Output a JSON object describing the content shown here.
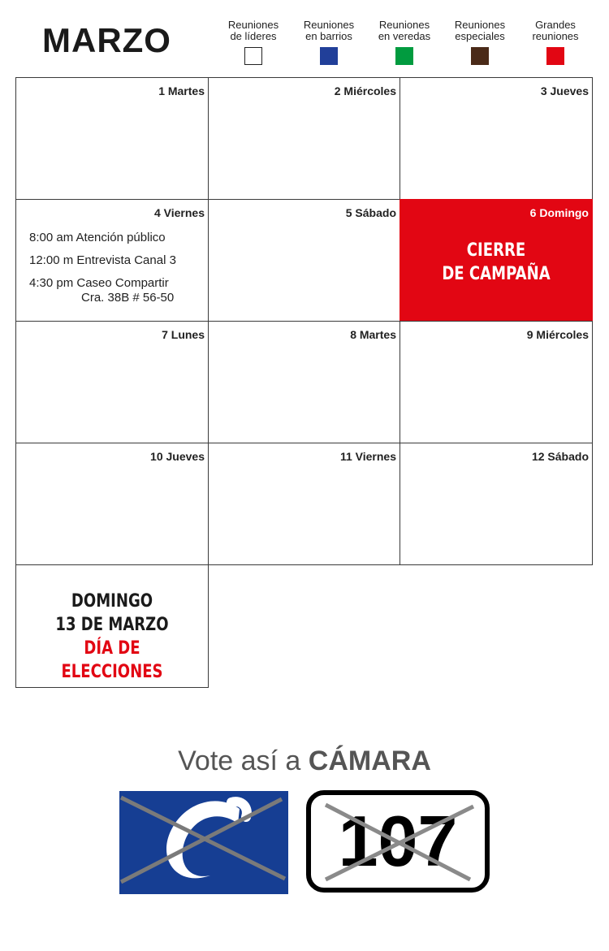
{
  "header": {
    "title": "MARZO"
  },
  "legend": [
    {
      "label": "Reuniones\nde líderes",
      "color": "#ffffff"
    },
    {
      "label": "Reuniones\nen barrios",
      "color": "#213f99"
    },
    {
      "label": "Reuniones\nen veredas",
      "color": "#019b3f"
    },
    {
      "label": "Reuniones\nespeciales",
      "color": "#4a2a18"
    },
    {
      "label": "Grandes\nreuniones",
      "color": "#e20613"
    }
  ],
  "days": [
    {
      "label": "1 Martes"
    },
    {
      "label": "2 Miércoles"
    },
    {
      "label": "3 Jueves"
    },
    {
      "label": "4 Viernes"
    },
    {
      "label": "5 Sábado"
    },
    {
      "label": "6 Domingo"
    },
    {
      "label": "7 Lunes"
    },
    {
      "label": "8 Martes"
    },
    {
      "label": "9 Miércoles"
    },
    {
      "label": "10 Jueves"
    },
    {
      "label": "11 Viernes"
    },
    {
      "label": "12 Sábado"
    }
  ],
  "events_day4": [
    {
      "text": "8:00 am Atención público"
    },
    {
      "text": "12:00 m Entrevista Canal 3"
    },
    {
      "text": "4:30 pm Caseo Compartir",
      "sub": "Cra. 38B # 56-50"
    }
  ],
  "highlight": {
    "line1": "CIERRE",
    "line2": "DE CAMPAÑA",
    "color": "#e20613"
  },
  "election": {
    "line1": "DOMINGO",
    "line2": "13 DE MARZO",
    "line3": "DÍA DE ELECCIONES"
  },
  "vote": {
    "prefix": "Vote así a ",
    "strong": "CÁMARA"
  },
  "ballot": {
    "number": "107",
    "logo_color": "#163e93"
  }
}
